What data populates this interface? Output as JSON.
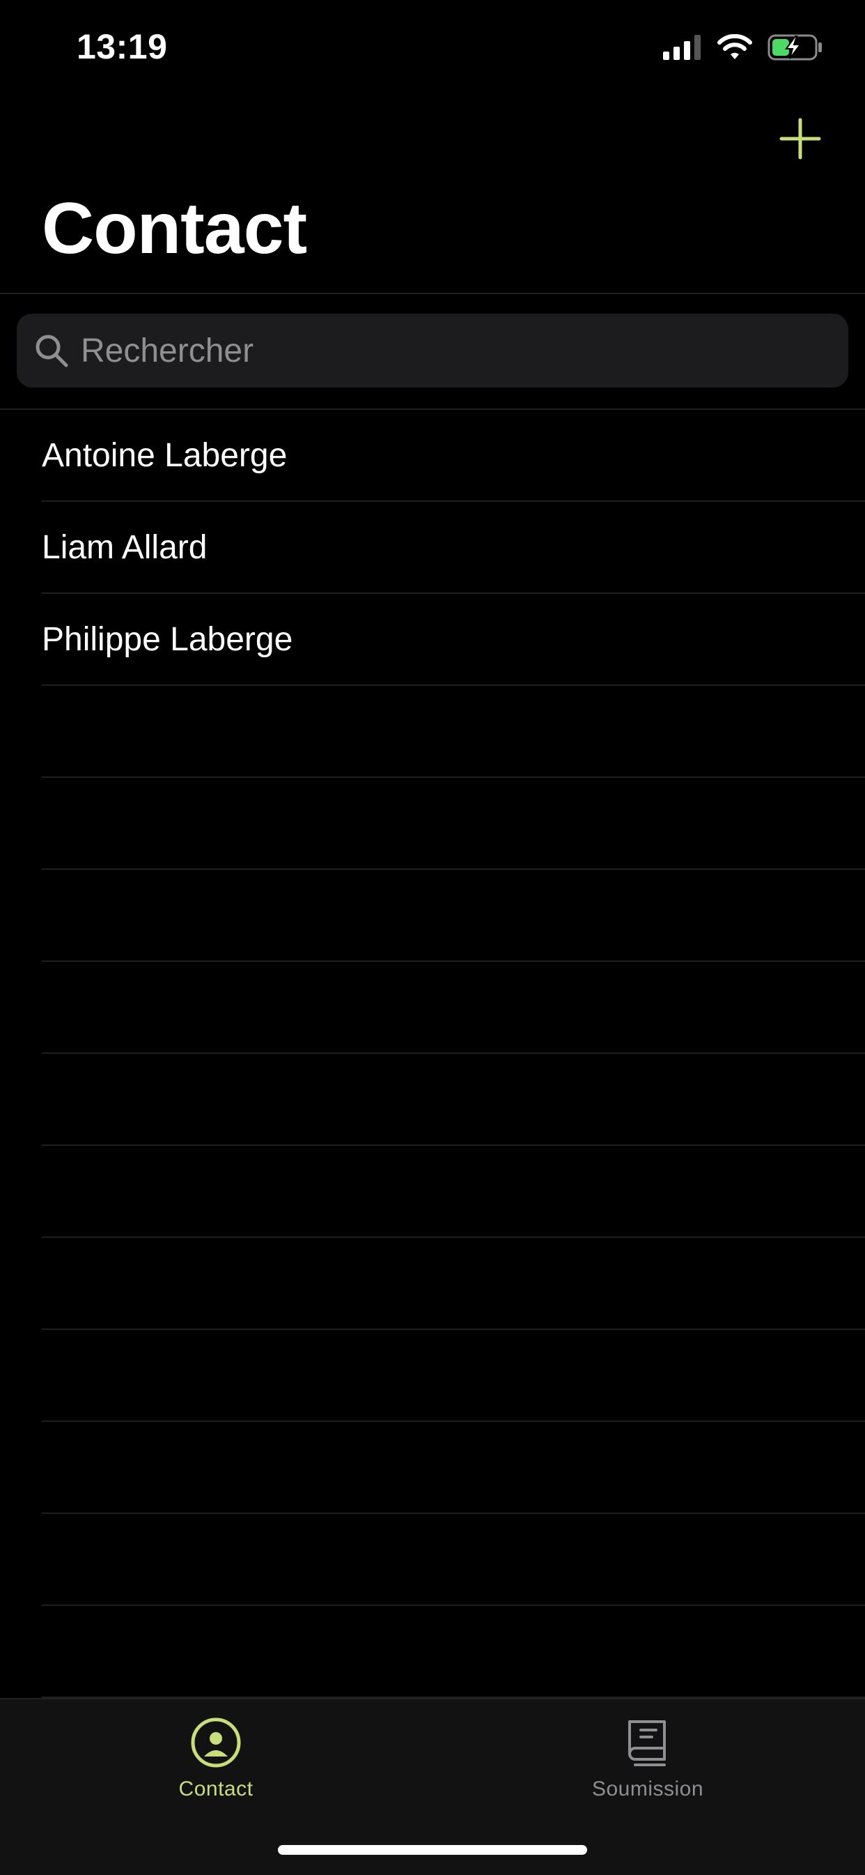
{
  "status_bar": {
    "time": "13:19"
  },
  "header": {
    "title": "Contact",
    "add_icon": "plus-icon"
  },
  "search": {
    "placeholder": "Rechercher",
    "value": ""
  },
  "contacts": [
    {
      "name": "Antoine Laberge"
    },
    {
      "name": "Liam Allard"
    },
    {
      "name": "Philippe Laberge"
    }
  ],
  "tab_bar": {
    "tabs": [
      {
        "label": "Contact",
        "icon": "person-circle-icon",
        "selected": true
      },
      {
        "label": "Soumission",
        "icon": "book-icon",
        "selected": false
      }
    ]
  },
  "colors": {
    "accent": "#c8de7a",
    "background": "#000000",
    "search_background": "#1c1c1e",
    "inactive": "#8e8e93",
    "battery_fill": "#4cd964"
  }
}
